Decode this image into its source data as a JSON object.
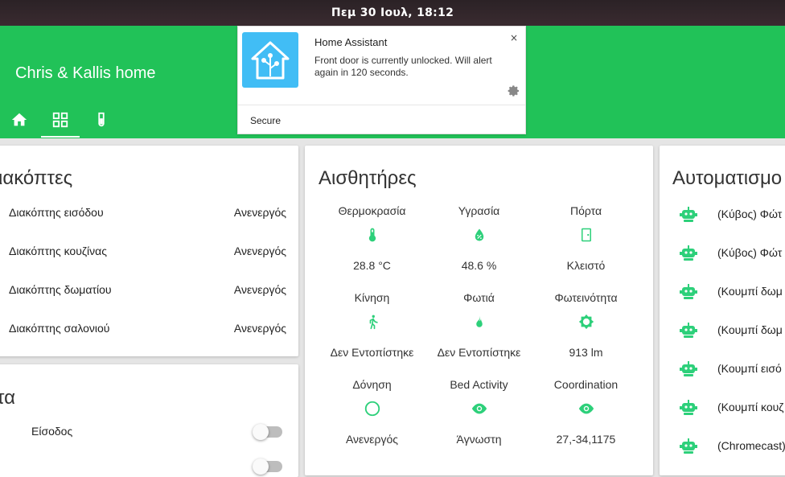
{
  "system_bar": {
    "datetime": "Πεμ 30 Ιουλ, 18:12"
  },
  "header": {
    "title": "Chris & Kallis home",
    "tabs": [
      {
        "icon": "home-icon"
      },
      {
        "icon": "dashboard-grid-icon"
      },
      {
        "icon": "test-tube-icon"
      }
    ],
    "accent_color": "#21c258"
  },
  "notification": {
    "app_name": "Home Assistant",
    "message": "Front door is currently unlocked. Will alert again in 120 seconds.",
    "action": "Secure",
    "close": "×"
  },
  "switches_card": {
    "title": "ιακόπτες",
    "rows": [
      {
        "name": "Διακόπτης εισόδου",
        "state": "Ανενεργός"
      },
      {
        "name": "Διακόπτης κουζίνας",
        "state": "Ανενεργός"
      },
      {
        "name": "Διακόπτης δωματίου",
        "state": "Ανενεργός"
      },
      {
        "name": "Διακόπτης σαλονιού",
        "state": "Ανενεργός"
      }
    ]
  },
  "locks_card": {
    "title": "τα",
    "rows": [
      {
        "name": "Είσοδος",
        "on": false
      }
    ]
  },
  "sensors_card": {
    "title": "Αισθητήρες",
    "items": [
      {
        "label": "Θερμοκρασία",
        "icon": "thermometer-icon",
        "value": "28.8 °C"
      },
      {
        "label": "Υγρασία",
        "icon": "water-percent-icon",
        "value": "48.6 %"
      },
      {
        "label": "Πόρτα",
        "icon": "door-icon",
        "value": "Κλειστό"
      },
      {
        "label": "Κίνηση",
        "icon": "walk-icon",
        "value": "Δεν Εντοπίστηκε"
      },
      {
        "label": "Φωτιά",
        "icon": "fire-icon",
        "value": "Δεν Εντοπίστηκε"
      },
      {
        "label": "Φωτεινότητα",
        "icon": "brightness-icon",
        "value": "913 lm"
      },
      {
        "label": "Δόνηση",
        "icon": "circle-outline-icon",
        "value": "Ανενεργός"
      },
      {
        "label": "Bed Activity",
        "icon": "eye-icon",
        "value": "Άγνωστη"
      },
      {
        "label": "Coordination",
        "icon": "eye-icon",
        "value": "27,-34,1175"
      }
    ]
  },
  "automations_card": {
    "title": "Αυτοματισμο",
    "items": [
      {
        "name": "(Κύβος) Φώτ"
      },
      {
        "name": "(Κύβος) Φώτ"
      },
      {
        "name": "(Κουμπί δωμ"
      },
      {
        "name": "(Κουμπί δωμ"
      },
      {
        "name": "(Κουμπί εισό"
      },
      {
        "name": "(Κουμπί κουζ"
      },
      {
        "name": "(Chromecast)"
      }
    ]
  }
}
